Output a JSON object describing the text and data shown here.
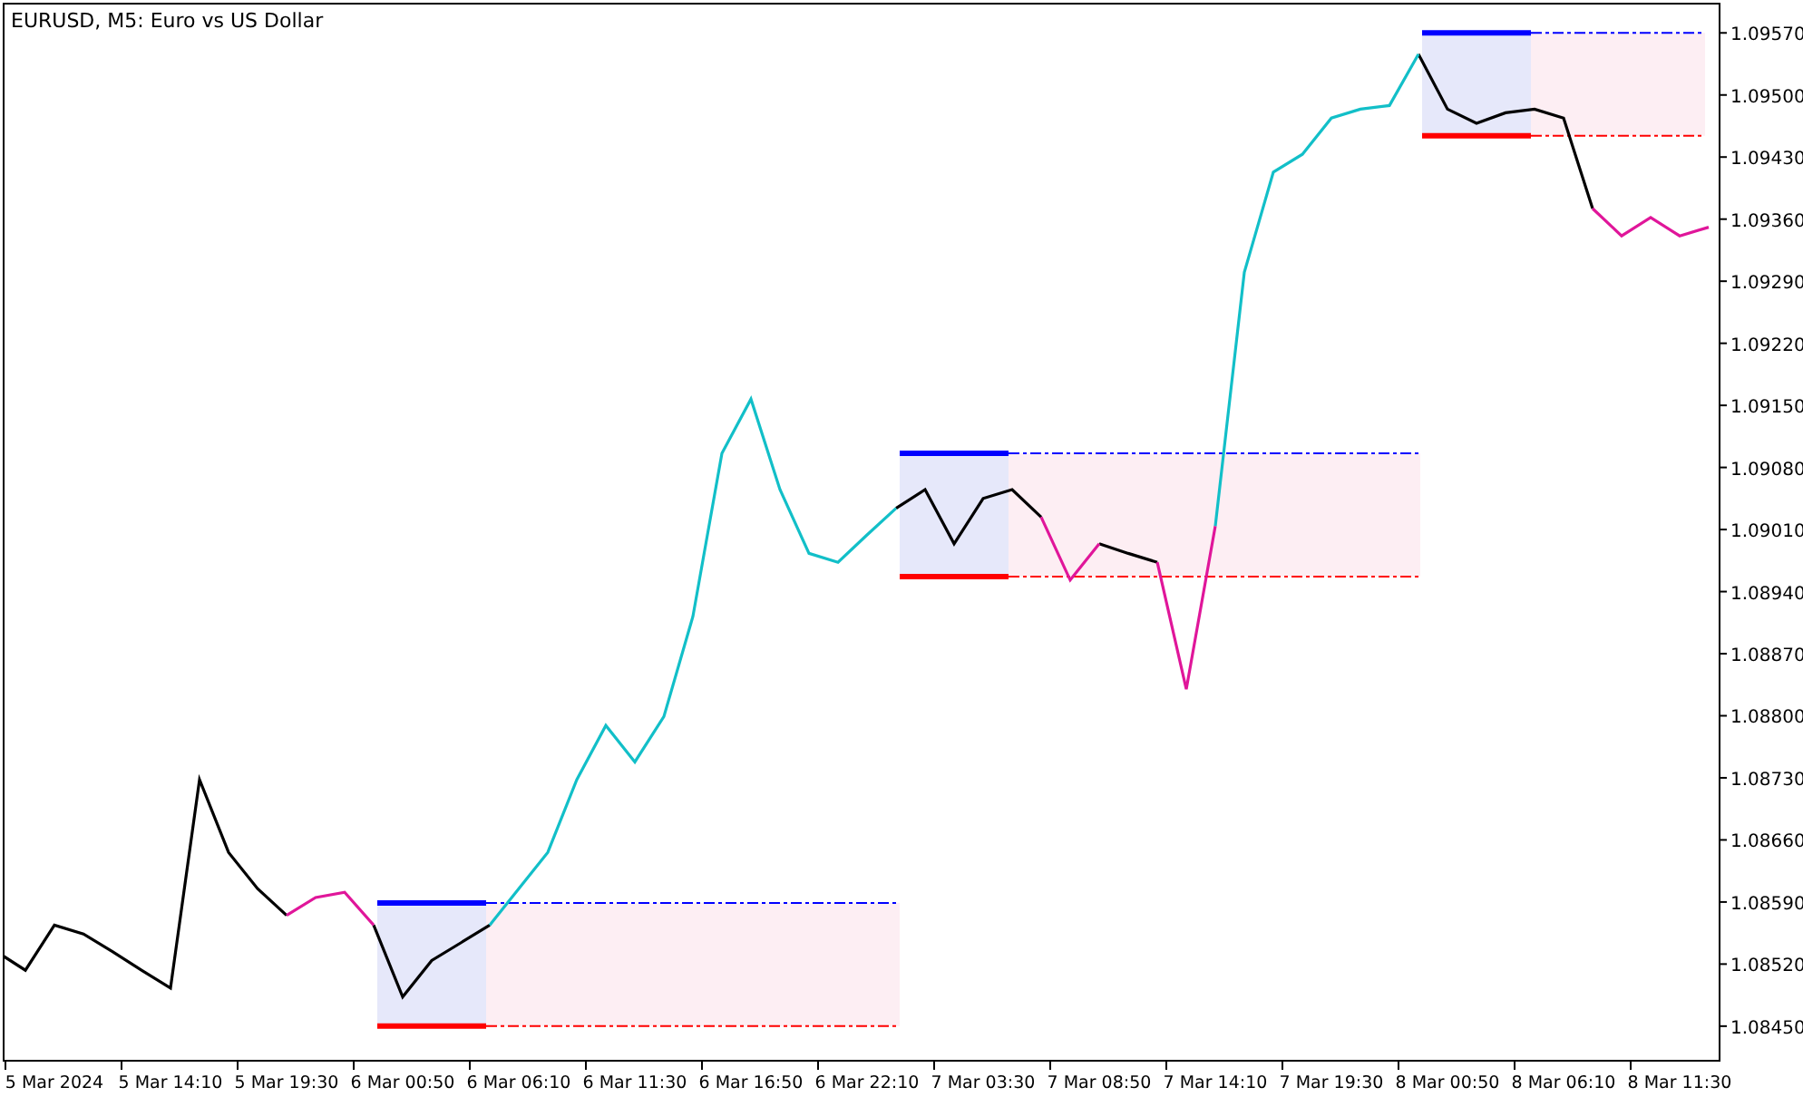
{
  "chart": {
    "chart_data": {
      "type": "line",
      "title": "EURUSD, M5:  Euro vs US Dollar",
      "categories": [
        null,
        null,
        "5 Mar 2024",
        null,
        null,
        null,
        "5 Mar 14:10",
        null,
        null,
        null,
        "5 Mar 19:30",
        null,
        null,
        null,
        "6 Mar 00:50",
        null,
        null,
        null,
        "6 Mar 06:10",
        null,
        null,
        null,
        "6 Mar 11:30",
        null,
        null,
        null,
        "6 Mar 16:50",
        null,
        null,
        null,
        "6 Mar 22:10",
        null,
        null,
        null,
        "7 Mar 03:30",
        null,
        null,
        null,
        "7 Mar 08:50",
        null,
        null,
        null,
        "7 Mar 14:10",
        null,
        null,
        null,
        "7 Mar 19:30",
        null,
        null,
        null,
        "8 Mar 00:50",
        null,
        null,
        null,
        "8 Mar 06:10",
        null,
        null,
        null,
        "8 Mar 11:30",
        null
      ],
      "series": [
        {
          "color": "#000000",
          "values": [
            1.08534,
            1.08513,
            1.08564,
            1.08554,
            1.08534,
            1.08513,
            1.08493,
            1.08728,
            1.08646,
            1.08605,
            1.08575,
            null,
            null,
            1.08564,
            1.08483,
            1.08524,
            1.08544,
            1.08564,
            null,
            null,
            null,
            null,
            null,
            null,
            null,
            null,
            null,
            null,
            null,
            null,
            null,
            1.09034,
            1.09055,
            1.08994,
            1.09045,
            1.09055,
            1.09024,
            null,
            1.08994,
            1.08983,
            1.08973,
            null,
            null,
            null,
            null,
            null,
            null,
            null,
            null,
            1.09546,
            1.09484,
            1.09468,
            1.0948,
            1.09484,
            1.09474,
            1.09372,
            null,
            null,
            null,
            null
          ]
        },
        {
          "color": "#e0169a",
          "values": [
            null,
            null,
            null,
            null,
            null,
            null,
            null,
            null,
            null,
            null,
            1.08575,
            1.08595,
            1.08601,
            1.08564,
            null,
            null,
            null,
            null,
            null,
            null,
            null,
            null,
            null,
            null,
            null,
            null,
            null,
            null,
            null,
            null,
            null,
            null,
            null,
            null,
            null,
            null,
            1.09024,
            1.08953,
            1.08994,
            null,
            1.08973,
            1.0883,
            1.09014,
            null,
            null,
            null,
            null,
            null,
            null,
            null,
            null,
            null,
            null,
            null,
            null,
            1.09372,
            1.09341,
            1.09362,
            1.09341,
            1.09351
          ]
        },
        {
          "color": "#12bfc8",
          "values": [
            null,
            null,
            null,
            null,
            null,
            null,
            null,
            null,
            null,
            null,
            null,
            null,
            null,
            null,
            null,
            null,
            null,
            1.08564,
            1.08605,
            1.08646,
            1.08728,
            1.08789,
            1.08748,
            1.08799,
            1.08912,
            1.09096,
            1.09157,
            1.09055,
            1.08983,
            1.08973,
            1.09004,
            1.09034,
            null,
            null,
            null,
            null,
            null,
            null,
            null,
            null,
            null,
            null,
            1.09014,
            1.093,
            1.09413,
            1.09433,
            1.09474,
            1.09484,
            1.09488,
            1.09546,
            null,
            null,
            null,
            null,
            null,
            null,
            null,
            null,
            null,
            null
          ]
        }
      ],
      "ylim": [
        1.08411,
        1.09603
      ],
      "yticks": [
        {
          "value": 1.0957,
          "label": "1.09570"
        },
        {
          "value": 1.095,
          "label": "1.09500"
        },
        {
          "value": 1.0943,
          "label": "1.09430"
        },
        {
          "value": 1.0936,
          "label": "1.09360"
        },
        {
          "value": 1.0929,
          "label": "1.09290"
        },
        {
          "value": 1.0922,
          "label": "1.09220"
        },
        {
          "value": 1.0915,
          "label": "1.09150"
        },
        {
          "value": 1.0908,
          "label": "1.09080"
        },
        {
          "value": 1.0901,
          "label": "1.09010"
        },
        {
          "value": 1.0894,
          "label": "1.08940"
        },
        {
          "value": 1.0887,
          "label": "1.08870"
        },
        {
          "value": 1.088,
          "label": "1.08800"
        },
        {
          "value": 1.0873,
          "label": "1.08730"
        },
        {
          "value": 1.0866,
          "label": "1.08660"
        },
        {
          "value": 1.0859,
          "label": "1.08590"
        },
        {
          "value": 1.0852,
          "label": "1.08520"
        },
        {
          "value": 1.0845,
          "label": "1.08450"
        }
      ]
    }
  }
}
